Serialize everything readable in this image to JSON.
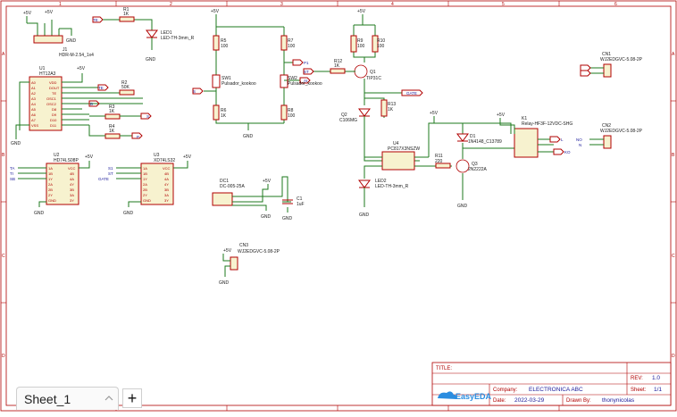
{
  "tab": {
    "sheet_name": "Sheet_1",
    "add_label": "+"
  },
  "border": {
    "cols": [
      "1",
      "2",
      "3",
      "4",
      "5",
      "6"
    ],
    "rows": [
      "A",
      "B",
      "C",
      "D"
    ]
  },
  "title_block": {
    "title_label": "TITLE:",
    "title_value": "",
    "rev_label": "REV:",
    "rev_value": "1.0",
    "company_label": "Company:",
    "company_value": "ELECTRONICA ABC",
    "sheet_label": "Sheet:",
    "sheet_value": "1/1",
    "date_label": "Date:",
    "date_value": "2022-03-29",
    "drawn_label": "Drawn By:",
    "drawn_value": "thonynicolas",
    "logo_text": "EasyEDA"
  },
  "power": {
    "vcc": "+5V",
    "gnd": "GND"
  },
  "components": {
    "j1": {
      "ref": "J1",
      "value": "HDR-M-2.54_1x4"
    },
    "u1": {
      "ref": "U1",
      "value": "HT12A3",
      "left_pins": [
        "A0",
        "A1",
        "A2",
        "A3",
        "A4",
        "A5",
        "A6",
        "A7",
        "VSS"
      ],
      "right_pins": [
        "VDD",
        "DOUT",
        "TE",
        "OSC1",
        "OSC2",
        "D8",
        "D9",
        "D10",
        "D11"
      ]
    },
    "r1": {
      "ref": "R1",
      "value": "1K"
    },
    "led1": {
      "ref": "LED1",
      "value": "LED-TH-3mm_R"
    },
    "r2": {
      "ref": "R2",
      "value": "50K"
    },
    "r3": {
      "ref": "R3",
      "value": "1K"
    },
    "r4": {
      "ref": "R4",
      "value": "1K"
    },
    "u2": {
      "ref": "U2",
      "value": "HD74LS08P",
      "left_pins": [
        "1A",
        "1B",
        "1Y",
        "2A",
        "2B",
        "2Y",
        "GND"
      ],
      "right_pins": [
        "VCC",
        "4B",
        "4A",
        "4Y",
        "3B",
        "3A",
        "3Y"
      ]
    },
    "u3": {
      "ref": "U3",
      "value": "XD74LS32",
      "left_pins": [
        "1A",
        "1B",
        "1Y",
        "2A",
        "2B",
        "2Y",
        "GND"
      ],
      "right_pins": [
        "VCC",
        "4B",
        "4A",
        "4Y",
        "3B",
        "3A",
        "3Y"
      ]
    },
    "r5": {
      "ref": "R5",
      "value": "100"
    },
    "r6": {
      "ref": "R6",
      "value": "1K"
    },
    "sw1": {
      "ref": "SW1",
      "value": "Pulsador_kookoo"
    },
    "r7": {
      "ref": "R7",
      "value": "100"
    },
    "r8": {
      "ref": "R8",
      "value": "100"
    },
    "sw2": {
      "ref": "SW2",
      "value": "Pulsador_kookoo"
    },
    "dc1": {
      "ref": "DC1",
      "value": "DC-005-25A"
    },
    "c1": {
      "ref": "C1",
      "value": "1uF"
    },
    "cn3": {
      "ref": "CN3",
      "value": "WJ2EDGVC-5.08-2P"
    },
    "r9": {
      "ref": "R9",
      "value": "100"
    },
    "r10": {
      "ref": "R10",
      "value": "100"
    },
    "r12": {
      "ref": "R12",
      "value": "1K"
    },
    "q1": {
      "ref": "Q1",
      "value": "TIP31C"
    },
    "q2": {
      "ref": "Q2",
      "value": "C106MG"
    },
    "r13": {
      "ref": "R13",
      "value": "1K"
    },
    "u4": {
      "ref": "U4",
      "value": "PC817X3NSZW"
    },
    "led2": {
      "ref": "LED2",
      "value": "LED-TH-3mm_R"
    },
    "r11": {
      "ref": "R11",
      "value": "220"
    },
    "q3": {
      "ref": "Q3",
      "value": "2N2222A"
    },
    "d1": {
      "ref": "D1",
      "value": "1N4148_C13789"
    },
    "k1": {
      "ref": "K1",
      "value": "Relay-HF3F-12VDC-SHG"
    },
    "cn1": {
      "ref": "CN1",
      "value": "WJ2EDGVC-5.08-2P"
    },
    "cn2": {
      "ref": "CN2",
      "value": "WJ2EDGVC-5.08-2P"
    }
  },
  "nets": {
    "te": "TE",
    "s": "S",
    "st": "ST",
    "p": "P",
    "d": "D",
    "l": "L",
    "gate": "GATE",
    "no": "NO",
    "n": "N",
    "ko": "KO",
    "ta": "TA",
    "ti": "TI",
    "sb": "SB",
    "s1": "S1",
    "p1": "P1",
    "ai": "AI"
  }
}
